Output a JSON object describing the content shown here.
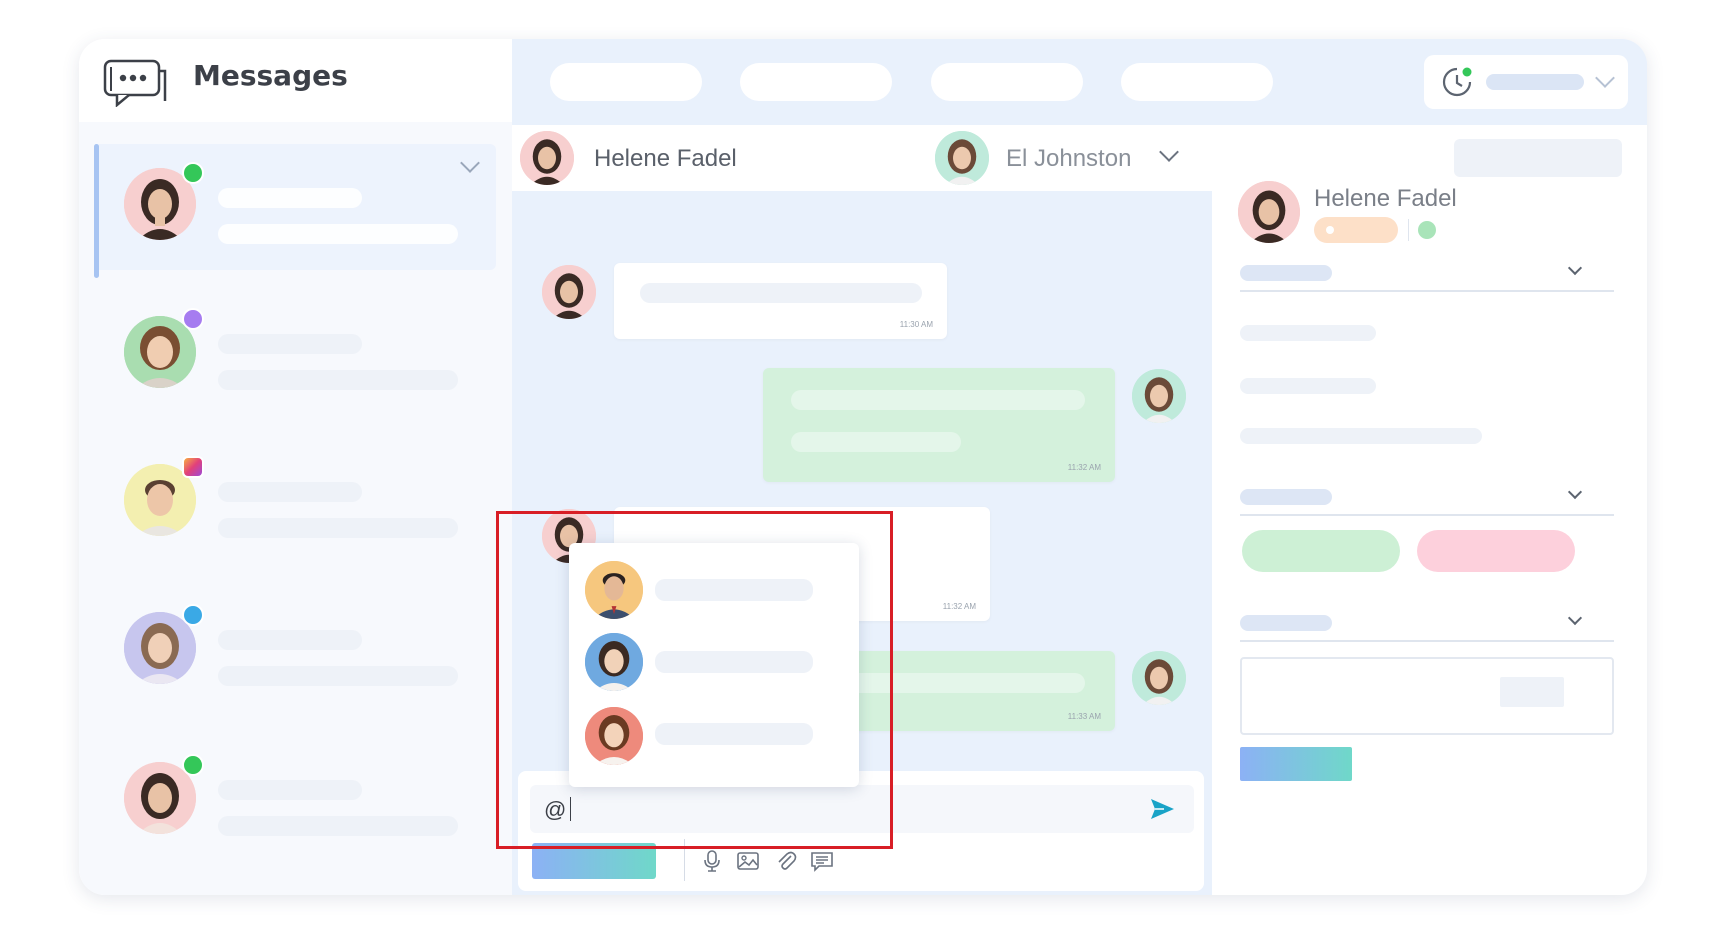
{
  "app": {
    "title": "Messages"
  },
  "icons": {
    "logo": "chat-bubble-icon",
    "status": "clock-icon",
    "send": "send-icon",
    "mic": "microphone-icon",
    "image": "image-icon",
    "attach": "paperclip-icon",
    "template": "message-template-icon"
  },
  "conversations": [
    {
      "channel": "whatsapp",
      "active": true
    },
    {
      "channel": "messenger",
      "active": false
    },
    {
      "channel": "instagram",
      "active": false
    },
    {
      "channel": "telegram",
      "active": false
    },
    {
      "channel": "whatsapp",
      "active": false
    }
  ],
  "chat_header": {
    "contact_name": "Helene Fadel",
    "assignee_name": "El Johnston"
  },
  "messages": [
    {
      "direction": "incoming",
      "time": "11:30 AM"
    },
    {
      "direction": "outgoing",
      "time": "11:32 AM",
      "read": true
    },
    {
      "direction": "incoming",
      "time": "11:32 AM"
    },
    {
      "direction": "outgoing",
      "time": "11:33 AM",
      "read": true
    }
  ],
  "composer": {
    "value": "@"
  },
  "mention_popup": {
    "count": 3
  },
  "contact_panel": {
    "name": "Helene Fadel",
    "channel": "whatsapp"
  },
  "colors": {
    "accent_blue": "#8cb1f5",
    "accent_teal": "#6fd8c9",
    "highlight_red": "#d81e26",
    "whatsapp_green": "#34c759",
    "incoming_bubble": "#ffffff",
    "outgoing_bubble": "#d4f1dc"
  }
}
